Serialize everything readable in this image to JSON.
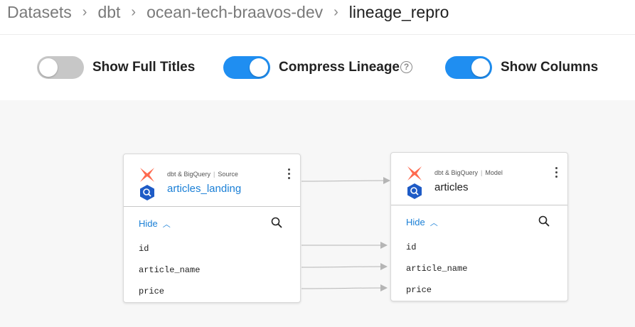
{
  "breadcrumb": [
    {
      "label": "Datasets"
    },
    {
      "label": "dbt"
    },
    {
      "label": "ocean-tech-braavos-dev"
    },
    {
      "label": "lineage_repro"
    }
  ],
  "breadcrumb_separator": "›",
  "toggles": [
    {
      "label": "Show Full Titles",
      "on": false
    },
    {
      "label": "Compress Lineage",
      "on": true,
      "help": "?"
    },
    {
      "label": "Show Columns",
      "on": true
    }
  ],
  "nodes": [
    {
      "platform": "dbt & BigQuery",
      "subtype": "Source",
      "title": "articles_landing",
      "hide_label": "Hide",
      "columns": [
        "id",
        "article_name",
        "price"
      ]
    },
    {
      "platform": "dbt & BigQuery",
      "subtype": "Model",
      "title": "articles",
      "hide_label": "Hide",
      "columns": [
        "id",
        "article_name",
        "price"
      ]
    }
  ],
  "colors": {
    "accent": "#1f8ef1",
    "link": "#1a7fd6",
    "dbt_orange": "#fe6a4f",
    "bigquery_blue": "#1e5bc6",
    "edge": "#b5b5b5"
  },
  "icons": {
    "dbt": "dbt-logo-icon",
    "bigquery": "bigquery-icon",
    "search": "search-icon",
    "menu": "kebab-menu-icon",
    "collapse": "chevron-up-icon",
    "help": "help-circle-icon"
  }
}
